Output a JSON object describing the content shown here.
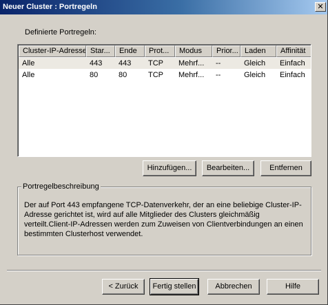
{
  "window": {
    "title": "Neuer Cluster : Portregeln",
    "close_glyph": "✕"
  },
  "main": {
    "defined_rules_label": "Definierte Portregeln:",
    "columns": [
      "Cluster-IP-Adresse",
      "Star...",
      "Ende",
      "Prot...",
      "Modus",
      "Prior...",
      "Laden",
      "Affinität"
    ],
    "rows": [
      [
        "Alle",
        "443",
        "443",
        "TCP",
        "Mehrf...",
        "--",
        "Gleich",
        "Einfach"
      ],
      [
        "Alle",
        "80",
        "80",
        "TCP",
        "Mehrf...",
        "--",
        "Gleich",
        "Einfach"
      ]
    ],
    "selected_row": 0,
    "buttons": {
      "add": "Hinzufügen...",
      "edit": "Bearbeiten...",
      "remove": "Entfernen"
    },
    "description": {
      "title": "Portregelbeschreibung",
      "text": "Der auf Port 443 empfangene TCP-Datenverkehr, der an eine beliebige Cluster-IP-Adresse gerichtet ist, wird auf alle Mitglieder des Clusters gleichmäßig verteilt.Client-IP-Adressen werden zum Zuweisen von Clientverbindungen an einen bestimmten Clusterhost verwendet."
    }
  },
  "footer": {
    "back": "< Zurück",
    "finish": "Fertig stellen",
    "cancel": "Abbrechen",
    "help": "Hilfe"
  },
  "colors": {
    "dialog_face": "#d4d0c8",
    "title_gradient_start": "#0a246a",
    "title_gradient_end": "#a6caf0",
    "selected_row": "#ece9e2"
  }
}
